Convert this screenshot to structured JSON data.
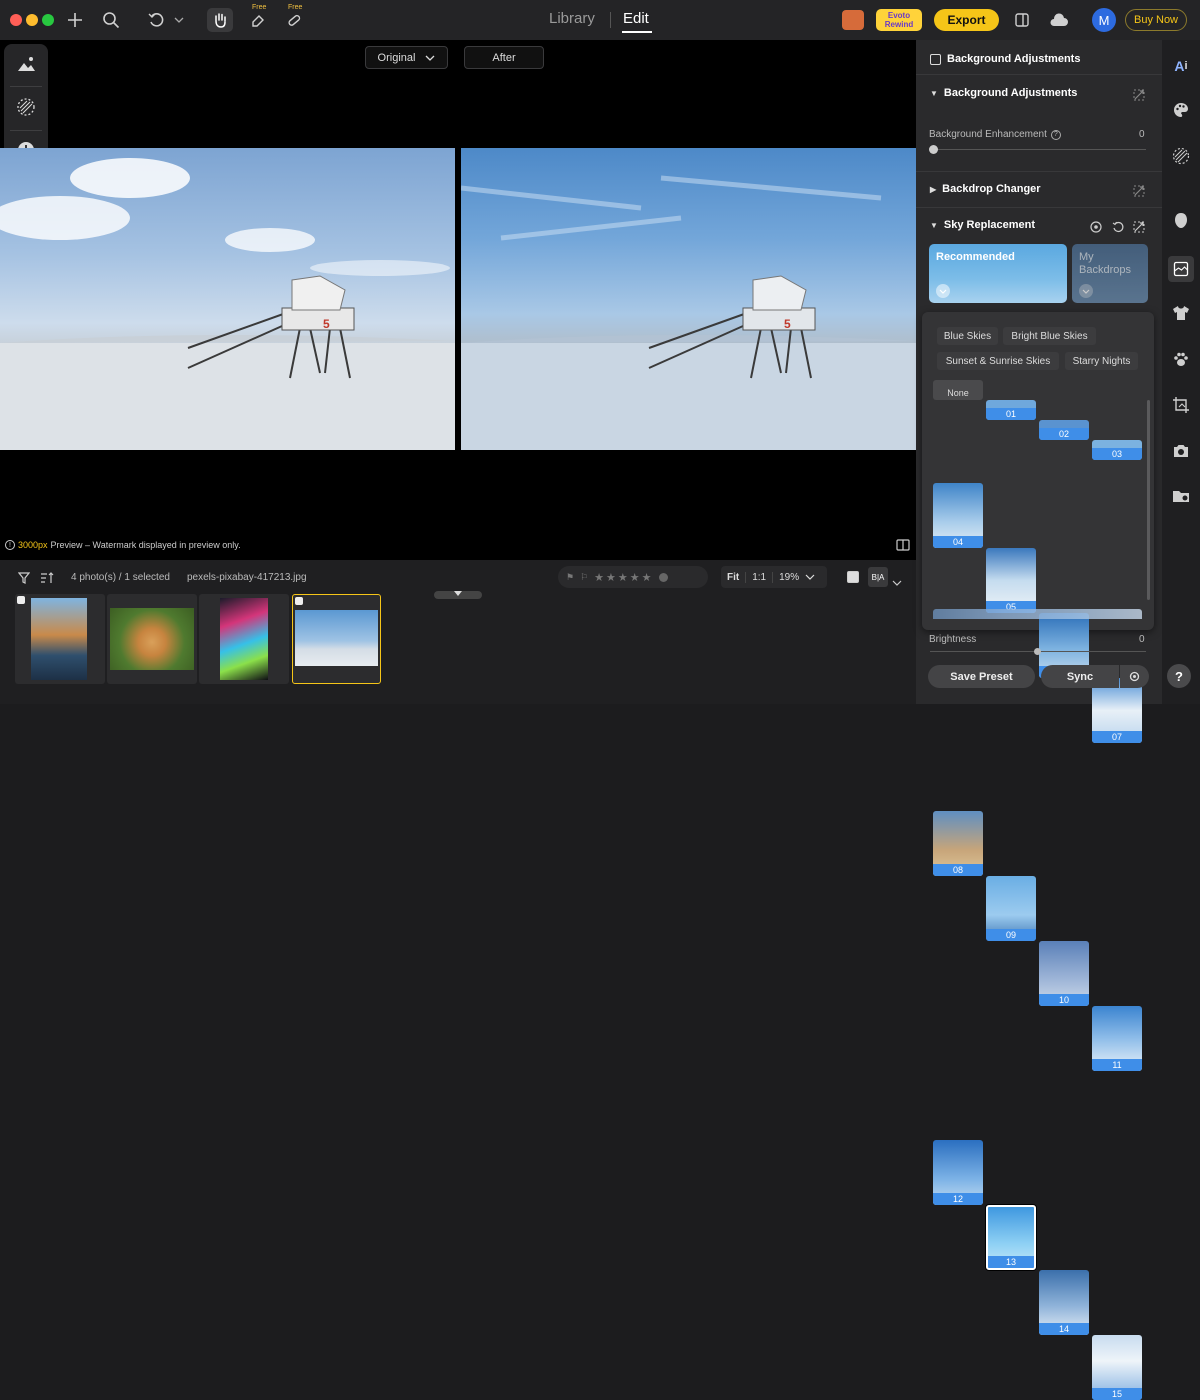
{
  "topbar": {
    "nav_tabs": [
      "Library",
      "Edit"
    ],
    "free_badge": "Free",
    "promo_text": "Evoto Rewind",
    "export_label": "Export",
    "avatar_letter": "M",
    "buy_label": "Buy Now"
  },
  "compare": {
    "original_label": "Original",
    "after_label": "After"
  },
  "preview_note": {
    "size": "3000px",
    "text": " Preview – Watermark displayed in preview only."
  },
  "filmstrip": {
    "count_text": "4 photo(s) / 1 selected",
    "filename": "pexels-pixabay-417213.jpg",
    "fit_label": "Fit",
    "ratio_label": "1:1",
    "zoom_value": "19%",
    "ba_label": "B|A"
  },
  "panel": {
    "header": "Background Adjustments",
    "section_bg": "Background Adjustments",
    "enhancement_label": "Background Enhancement",
    "enhancement_value": "0",
    "enhancement_level": 0,
    "backdrop_label": "Backdrop Changer",
    "sky_label": "Sky Replacement",
    "recommended_label": "Recommended",
    "mybackdrops_label": "My Backdrops",
    "categories": [
      "Blue Skies",
      "Bright Blue Skies",
      "Sunset & Sunrise Skies",
      "Starry Nights"
    ],
    "sky_tiles": [
      "None",
      "01",
      "02",
      "03",
      "04",
      "05",
      "06",
      "07",
      "08",
      "09",
      "10",
      "11",
      "12",
      "13",
      "14",
      "15"
    ],
    "selected_tile": "13",
    "brightness_label": "Brightness",
    "brightness_value": "0",
    "save_preset": "Save Preset",
    "sync_label": "Sync"
  },
  "sidebar_icons": [
    "ai-icon",
    "palette-icon",
    "texture-icon",
    "face-icon",
    "background-icon",
    "shirt-icon",
    "paw-icon",
    "crop-icon",
    "camera-icon",
    "folder-icon",
    "help-icon"
  ],
  "colors": {
    "accent_yellow": "#f5c518",
    "selection_blue": "#3f8ee8",
    "avatar_blue": "#2d6be0"
  }
}
